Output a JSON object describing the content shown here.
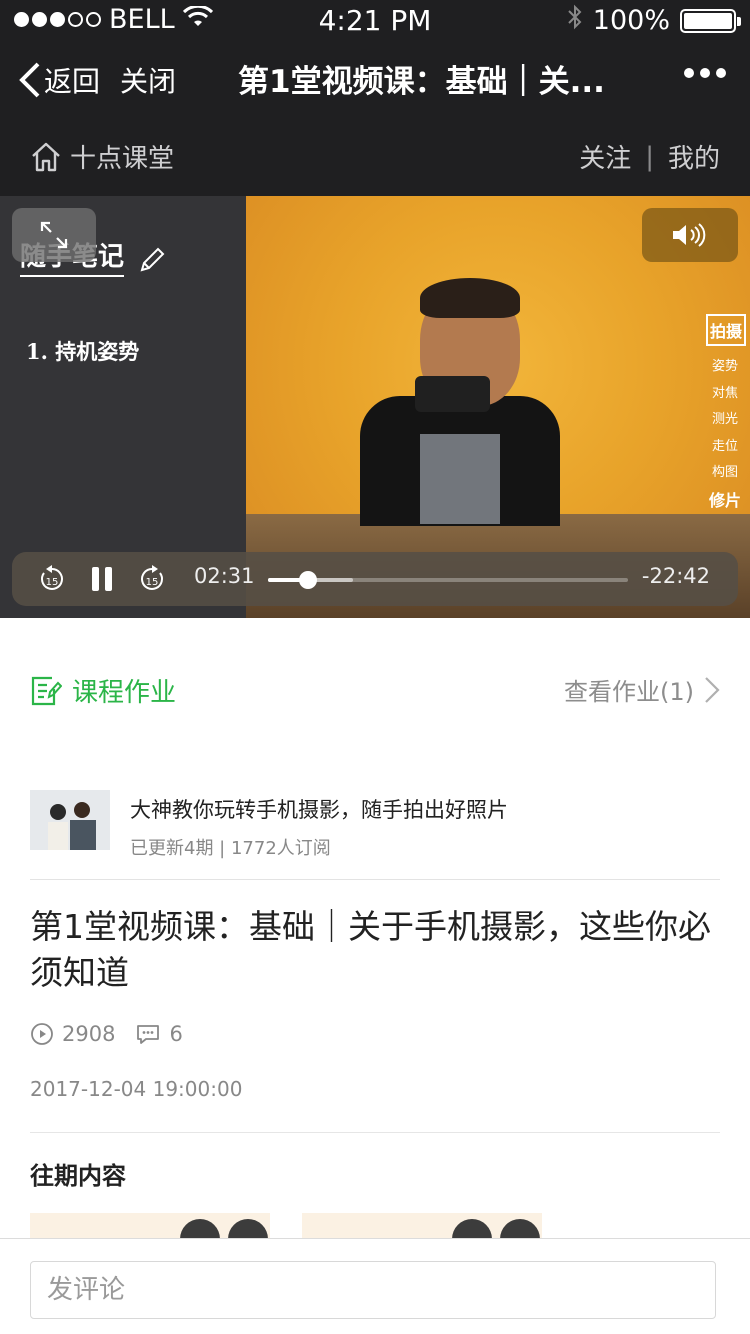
{
  "status": {
    "carrier": "BELL",
    "time": "4:21 PM",
    "battery": "100%"
  },
  "nav": {
    "back_label": "返回",
    "close_label": "关闭",
    "title": "第1堂视频课：基础｜关..."
  },
  "subnav": {
    "home_label": "十点课堂",
    "follow_label": "关注",
    "mine_label": "我的"
  },
  "video": {
    "note_title": "随手笔记",
    "note_item": "1. 持机姿势",
    "side_menu_head": "拍摄",
    "side_menu_items": [
      "姿势",
      "对焦",
      "测光",
      "走位",
      "构图"
    ],
    "side_menu_last": "修片",
    "skip_back_label": "15",
    "skip_fwd_label": "15",
    "current_time": "02:31",
    "remaining_time": "-22:42",
    "progress": 0.11
  },
  "homework": {
    "label": "课程作业",
    "view_label": "查看作业(1)"
  },
  "course": {
    "name": "大神教你玩转手机摄影，随手拍出好照片",
    "meta": "已更新4期 | 1772人订阅"
  },
  "article": {
    "title": "第1堂视频课：基础｜关于手机摄影，这些你必须知道",
    "plays": "2908",
    "comments": "6",
    "date": "2017-12-04 19:00:00"
  },
  "past": {
    "title": "往期内容"
  },
  "comment_box": {
    "placeholder": "发评论"
  },
  "colors": {
    "accent_green": "#2bb548",
    "header_bg": "#1f1f21"
  }
}
